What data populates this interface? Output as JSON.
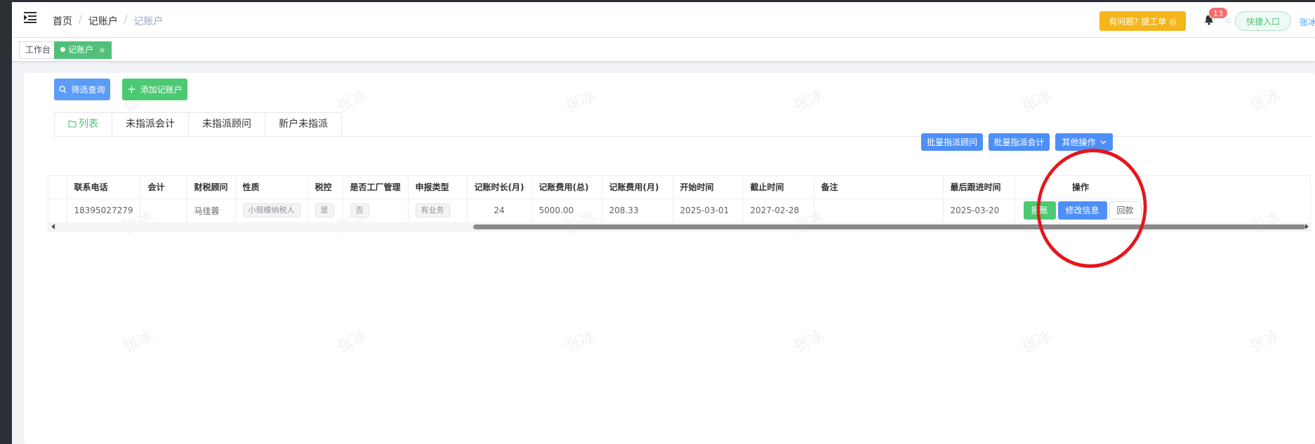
{
  "navbar": {
    "breadcrumb": [
      "首页",
      "记账户",
      "记账户"
    ],
    "ticket_button": "有问题? 提工单 ◎",
    "notification_count": "13",
    "dots": "::",
    "quick_entry": "快捷入口",
    "username": "张冰"
  },
  "tags": {
    "workbench": "工作台",
    "active": "记账户",
    "close": "×"
  },
  "toolbar": {
    "filter_button": "筛选查询",
    "add_button": "添加记账户",
    "batch_advisor_button": "批量指派顾问",
    "batch_accountant_button": "批量指派会计",
    "other_ops_button": "其他操作"
  },
  "tabs": [
    "列表",
    "未指派会计",
    "未指派顾问",
    "新户未指派"
  ],
  "watermark_text": "张冰",
  "table": {
    "columns": [
      "联系电话",
      "会计",
      "财税顾问",
      "性质",
      "税控",
      "是否工厂管理",
      "申报类型",
      "记账时长(月)",
      "记账费用(总)",
      "记账费用(月)",
      "开始时间",
      "截止时间",
      "备注",
      "最后跟进时间",
      "操作"
    ],
    "rows": [
      {
        "phone": "18395027279",
        "accountant": "",
        "advisor": "马佳蓉",
        "nature": "小规模纳税人",
        "tax_control": "是",
        "factory_mgmt": "否",
        "declare_type": "有业务",
        "duration": "24",
        "fee_total": "5000.00",
        "fee_month": "208.33",
        "start": "2025-03-01",
        "end": "2027-02-28",
        "remark": "",
        "last_follow": "2025-03-20",
        "ops": [
          "报账",
          "修改信息",
          "回款"
        ]
      }
    ]
  },
  "colors": {
    "accent_green": "#52c07b",
    "primary_blue": "#4e8ff7",
    "warning_yellow": "#f5b51b",
    "annotation_red": "#e8141b"
  }
}
